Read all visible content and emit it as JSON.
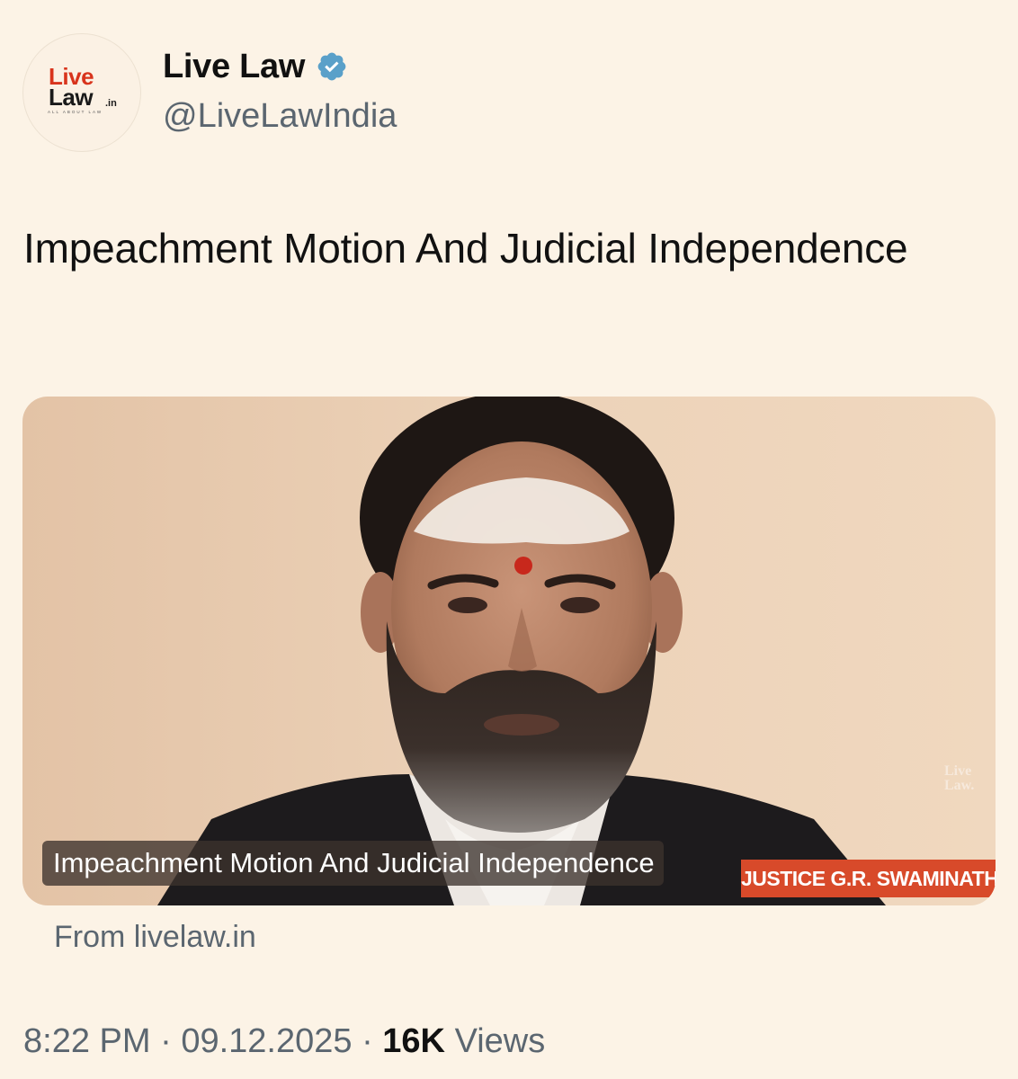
{
  "account": {
    "display_name": "Live Law",
    "handle": "@LiveLawIndia",
    "verified": true,
    "verified_color": "#5aa0c9",
    "avatar_icon": "livelaw-logo",
    "logo_text_live": "Live",
    "logo_text_law": "Law",
    "logo_text_domain": ".in",
    "logo_tagline": "ALL ABOUT LAW"
  },
  "tweet": {
    "text": "Impeachment Motion And Judicial Independence"
  },
  "card": {
    "image_caption": "Impeachment Motion And Judicial Independence",
    "name_plate": "JUSTICE G.R. SWAMINATHAN",
    "watermark": "Live Law.",
    "source": "From livelaw.in"
  },
  "meta": {
    "time": "8:22 PM",
    "separator": "·",
    "date": "09.12.2025",
    "views_count": "16K",
    "views_label": "Views"
  },
  "colors": {
    "background": "#fcf3e6",
    "brand_red": "#d8341c",
    "name_plate_red": "#d84a2a",
    "muted_text": "#5b6670"
  }
}
